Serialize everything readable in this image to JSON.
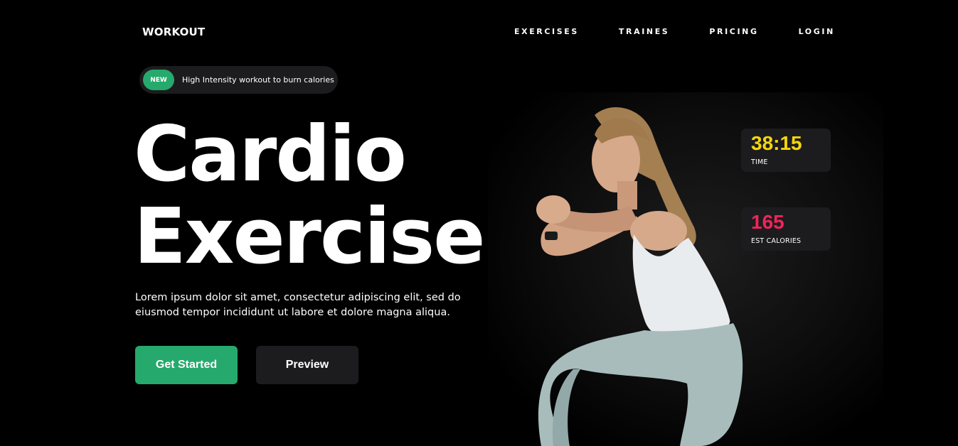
{
  "brand": {
    "logo": "WORKOUT"
  },
  "nav": {
    "items": [
      "EXERCISES",
      "TRAINES",
      "PRICING",
      "LOGIN"
    ]
  },
  "promo": {
    "badge": "NEW",
    "text": "High Intensity workout to burn calories"
  },
  "hero": {
    "title_line1": "Cardio",
    "title_line2": "Exercise",
    "description": "Lorem ipsum dolor sit amet, consectetur adipiscing elit, sed do eiusmod tempor incididunt ut labore et dolore magna aliqua.",
    "primary_button": "Get Started",
    "secondary_button": "Preview"
  },
  "stats": {
    "time": {
      "value": "38:15",
      "label": "TIME",
      "color": "#f5d60a"
    },
    "calories": {
      "value": "165",
      "label": "EST CALORIES",
      "color": "#f0245a"
    }
  },
  "colors": {
    "accent": "#26a96c",
    "card": "#1c1c1e",
    "background": "#000000"
  }
}
